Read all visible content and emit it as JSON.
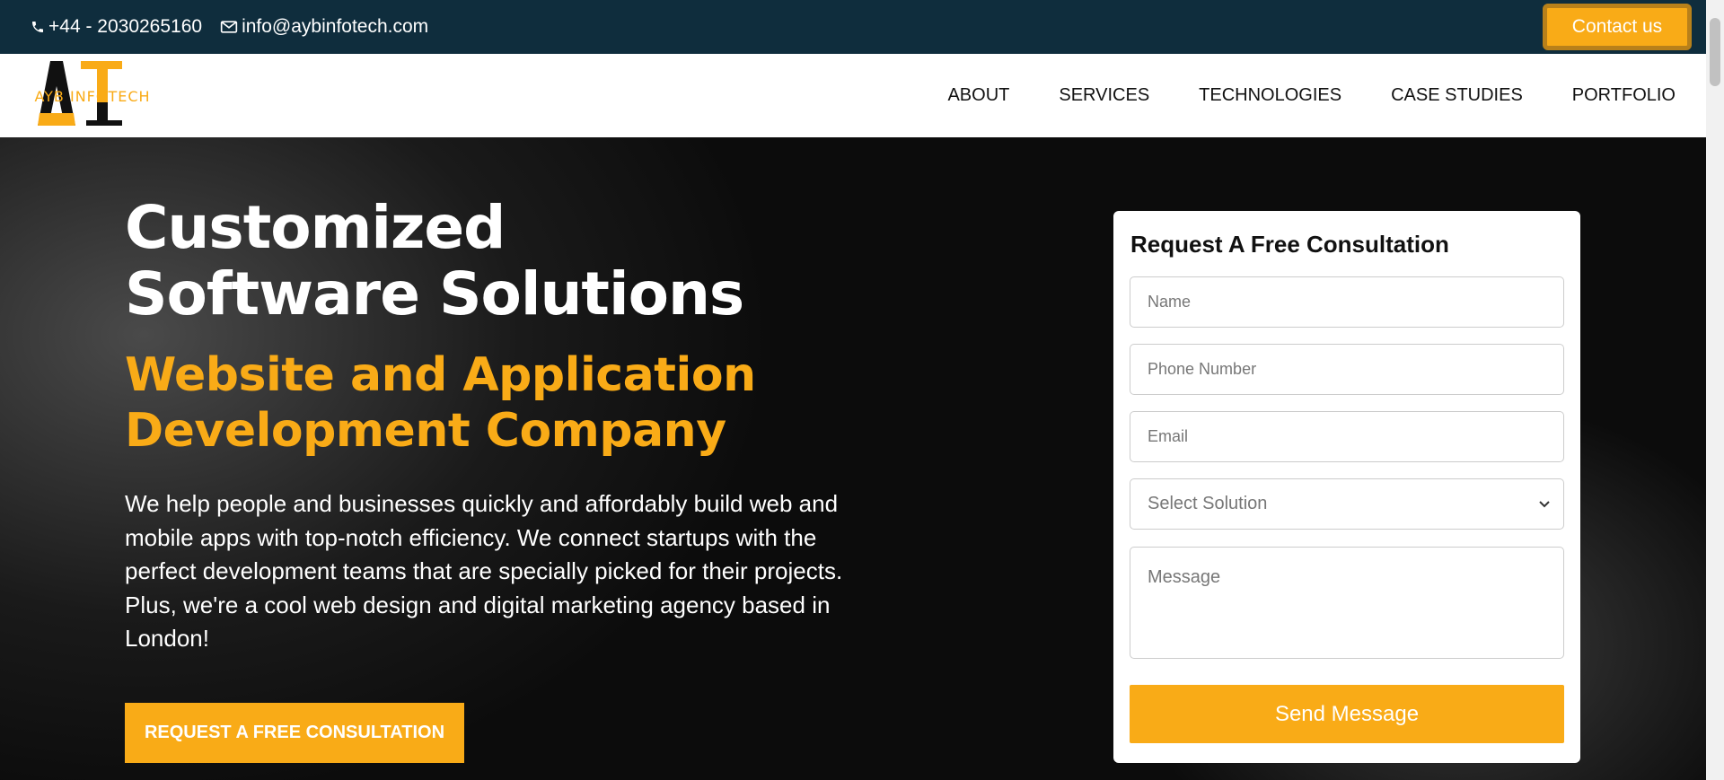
{
  "topbar": {
    "phone": "+44 - 2030265160",
    "email": "info@aybinfotech.com",
    "contact_label": "Contact us"
  },
  "brand": {
    "name": "AYB INFOTECH",
    "colors": {
      "accent": "#f9ab17",
      "topbar": "#0f2d3d"
    }
  },
  "nav": {
    "items": [
      "ABOUT",
      "SERVICES",
      "TECHNOLOGIES",
      "CASE STUDIES",
      "PORTFOLIO"
    ]
  },
  "hero": {
    "title": "Customized Software Solutions",
    "subtitle": "Website and Application Development Company",
    "description": "We help people and businesses quickly and affordably build web and mobile apps with top-notch efficiency. We connect startups with the perfect development teams that are specially picked for their projects. Plus, we're a cool web design and digital marketing agency based in London!",
    "cta_label": "REQUEST A FREE CONSULTATION"
  },
  "form": {
    "title": "Request A Free Consultation",
    "name_placeholder": "Name",
    "phone_placeholder": "Phone Number",
    "email_placeholder": "Email",
    "solution_selected": "Select Solution",
    "message_placeholder": "Message",
    "send_label": "Send Message"
  },
  "icons": [
    "phone-icon",
    "mail-icon",
    "chevron-down-icon"
  ]
}
